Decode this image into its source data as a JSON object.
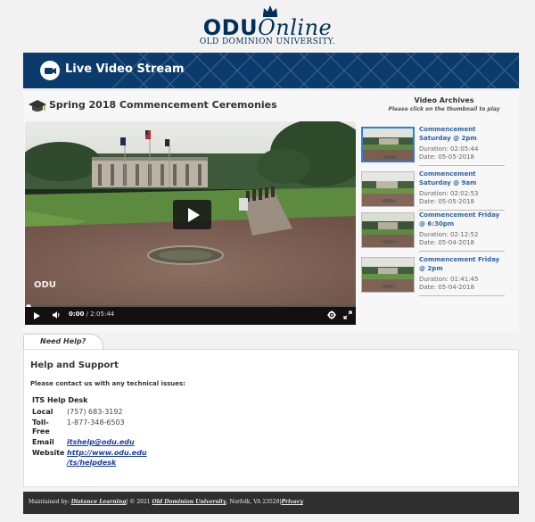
{
  "logo": {
    "brand_bold": "ODU",
    "brand_italic": "Online",
    "subtitle": "OLD DOMINION UNIVERSITY."
  },
  "banner": {
    "title": "Live Video Stream",
    "icon": "video-camera-icon"
  },
  "event": {
    "title": "Spring 2018 Commencement Ceremonies",
    "icon": "graduation-cap-icon"
  },
  "archives": {
    "title": "Video Archives",
    "subtitle": "Please click on the thumbnail to play",
    "items": [
      {
        "name": "Commencement Saturday @ 2pm",
        "duration": "Duration: 02:05:44",
        "date": "Date: 05-05-2018"
      },
      {
        "name": "Commencement Saturday @ 9am",
        "duration": "Duration: 02:02:53",
        "date": "Date: 05-05-2018"
      },
      {
        "name": "Commencement Friday @ 6:30pm",
        "duration": "Duration: 02:12:52",
        "date": "Date: 05-04-2018"
      },
      {
        "name": "Commencement Friday @ 2pm",
        "duration": "Duration: 01:41:45",
        "date": "Date: 05-04-2018"
      }
    ]
  },
  "player": {
    "current_time": "0:00",
    "total_time": "/ 2:05:44",
    "watermark": "ODU",
    "progress": 0
  },
  "help": {
    "tab_label": "Need Help?",
    "title": "Help and Support",
    "contact_line": "Please contact us with any technical issues:",
    "desk": "ITS Help Desk",
    "local_label": "Local",
    "local_value": "(757) 683-3192",
    "tollfree_label_1": "Toll-",
    "tollfree_label_2": "Free",
    "tollfree_value": "1-877-348-6503",
    "email_label": "Email",
    "email_value": "itshelp@odu.edu",
    "website_label": "Website",
    "website_value_1": "http://www.odu.edu",
    "website_value_2": "/ts/helpdesk"
  },
  "footer": {
    "maintained": "Maintained by:",
    "dl": "Distance Learning",
    "copyright": "| © 2021",
    "odu": "Old Dominion University",
    "location": ", Norfolk, VA 23529",
    "privacy": "Privacy",
    "pipe": "|"
  },
  "colors": {
    "navy": "#0b3a6c",
    "link": "#2e63a8",
    "footer": "#2f2f2f"
  }
}
